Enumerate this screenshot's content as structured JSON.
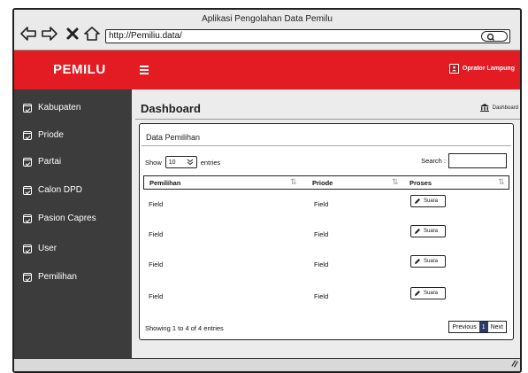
{
  "window": {
    "title": "Aplikasi Pengolahan Data Pemilu"
  },
  "browser": {
    "url": "http://Pemiliu.data/",
    "icons": [
      "back-arrow-icon",
      "forward-arrow-icon",
      "close-x-icon",
      "home-icon",
      "search-icon"
    ]
  },
  "topbar": {
    "brand": "PEMILU",
    "user_label": "Oprator Lampung"
  },
  "sidebar": {
    "items": [
      {
        "label": "Kabupaten"
      },
      {
        "label": "Priode"
      },
      {
        "label": "Partai"
      },
      {
        "label": "Calon DPD"
      },
      {
        "label": "Pasion Capres"
      },
      {
        "label": "User"
      },
      {
        "label": "Pemilihan"
      }
    ]
  },
  "page": {
    "title": "Dashboard",
    "breadcrumb": "Dashboard"
  },
  "box": {
    "title": "Data Pemilihan",
    "show_label": "Show",
    "show_value": "10",
    "entries_label": "entries",
    "search_label": "Search :",
    "columns": [
      "Pemilihan",
      "Priode",
      "Proses"
    ],
    "rows": [
      {
        "pemilihan": "Field",
        "priode": "Field",
        "action": "Suara"
      },
      {
        "pemilihan": "Field",
        "priode": "Field",
        "action": "Suara"
      },
      {
        "pemilihan": "Field",
        "priode": "Field",
        "action": "Suara"
      },
      {
        "pemilihan": "Field",
        "priode": "Field",
        "action": "Suara"
      }
    ],
    "info": "Showing 1 to 4 of 4 entries",
    "pager": {
      "previous": "Previous",
      "current": "1",
      "next": "Next"
    }
  },
  "colors": {
    "topbar": "#e31b23",
    "sidebar": "#3c3c3c",
    "active_page": "#2b3a66"
  }
}
